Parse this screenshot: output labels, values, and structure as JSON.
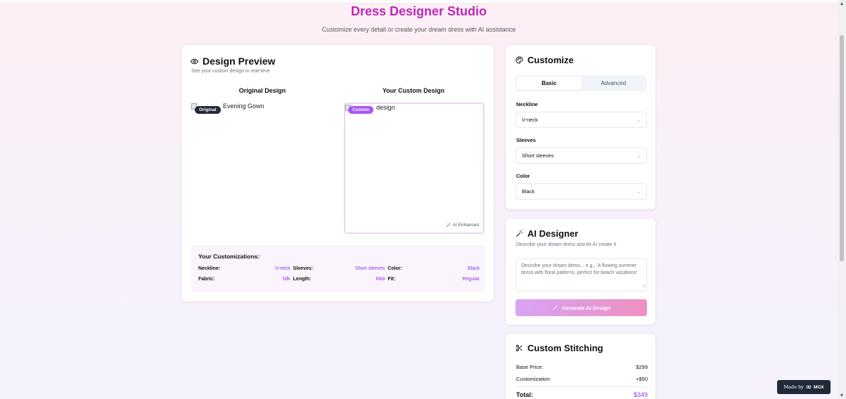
{
  "header": {
    "title": "Dress Designer Studio",
    "subtitle": "Customize every detail or create your dream dress with AI assistance"
  },
  "preview": {
    "title": "Design Preview",
    "subtitle": "See your custom design in real-time",
    "original_title": "Original Design",
    "custom_title": "Your Custom Design",
    "original_alt": "Evening Gown",
    "custom_alt": "design",
    "badge_original": "Original",
    "badge_custom": "Custom",
    "ai_enhanced": "AI Enhanced",
    "customizations_title": "Your Customizations:",
    "customizations": [
      {
        "key": "Neckline:",
        "value": "V-neck"
      },
      {
        "key": "Sleeves:",
        "value": "Short sleeves"
      },
      {
        "key": "Color:",
        "value": "Black"
      },
      {
        "key": "Fabric:",
        "value": "Silk"
      },
      {
        "key": "Length:",
        "value": "Midi"
      },
      {
        "key": "Fit:",
        "value": "Regular"
      }
    ]
  },
  "customize": {
    "title": "Customize",
    "tabs": [
      {
        "label": "Basic"
      },
      {
        "label": "Advanced"
      }
    ],
    "fields": [
      {
        "label": "Neckline",
        "value": "V-neck"
      },
      {
        "label": "Sleeves",
        "value": "Short sleeves"
      },
      {
        "label": "Color",
        "value": "Black"
      }
    ]
  },
  "ai_designer": {
    "title": "AI Designer",
    "subtitle": "Describe your dream dress and let AI create it",
    "placeholder": "Describe your dream dress... e.g., 'A flowing summer dress with floral patterns, perfect for beach vacations'",
    "button_label": "Generate AI Design"
  },
  "stitching": {
    "title": "Custom Stitching",
    "rows": [
      {
        "label": "Base Price:",
        "value": "$299"
      },
      {
        "label": "Customization:",
        "value": "+$50"
      }
    ],
    "total_label": "Total:",
    "total_value": "$349"
  },
  "made_by": {
    "prefix": "Made by",
    "brand": "MGX"
  },
  "colors": {
    "accent": "#c026b8",
    "purple": "#9333ea",
    "badge_dark": "#1f2937"
  },
  "icons": [
    "eye-icon",
    "palette-icon",
    "magic-wand-icon",
    "sparkles-icon",
    "scissors-icon",
    "chevron-down-icon",
    "broken-image-icon"
  ]
}
